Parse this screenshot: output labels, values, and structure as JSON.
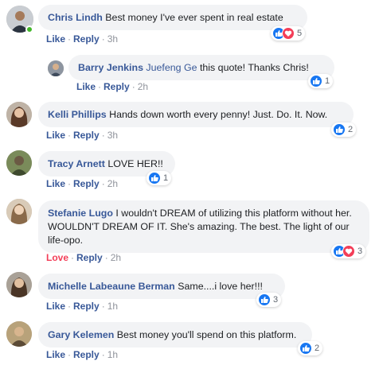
{
  "ui": {
    "like": "Like",
    "love": "Love",
    "reply": "Reply",
    "sep": "·"
  },
  "comments": [
    {
      "author": "Chris Lindh",
      "text": "Best money I've ever spent in real estate",
      "reaction": "Like",
      "time": "3h",
      "count": "5",
      "reactions": [
        "like",
        "love"
      ]
    },
    {
      "author": "Barry Jenkins",
      "mention": "Juefeng Ge",
      "text": "this quote! Thanks Chris!",
      "reaction": "Like",
      "time": "2h",
      "count": "1",
      "reactions": [
        "like"
      ]
    },
    {
      "author": "Kelli Phillips",
      "text": "Hands down worth every penny! Just. Do. It. Now.",
      "reaction": "Like",
      "time": "3h",
      "count": "2",
      "reactions": [
        "like"
      ]
    },
    {
      "author": "Tracy Arnett",
      "text": "LOVE HER!!",
      "reaction": "Like",
      "time": "2h",
      "count": "1",
      "reactions": [
        "like"
      ]
    },
    {
      "author": "Stefanie Lugo",
      "text": "I wouldn't DREAM of utilizing this platform without her. WOULDN'T DREAM OF IT. She's amazing. The best. The light of our life-opo.",
      "reaction": "Love",
      "time": "2h",
      "count": "3",
      "reactions": [
        "like",
        "love"
      ]
    },
    {
      "author": "Michelle Labeaune Berman",
      "text": "Same....i love her!!!",
      "reaction": "Like",
      "time": "1h",
      "count": "3",
      "reactions": [
        "like"
      ]
    },
    {
      "author": "Gary Kelemen",
      "text": "Best money you'll spend on this platform.",
      "reaction": "Like",
      "time": "1h",
      "count": "2",
      "reactions": [
        "like"
      ]
    }
  ],
  "colors": {
    "link": "#385898",
    "like": "#1877f2",
    "love": "#f33e58",
    "bubble": "#f2f3f5",
    "online": "#42b72a"
  },
  "icons": {
    "like": "thumbs-up-icon",
    "love": "heart-icon"
  }
}
